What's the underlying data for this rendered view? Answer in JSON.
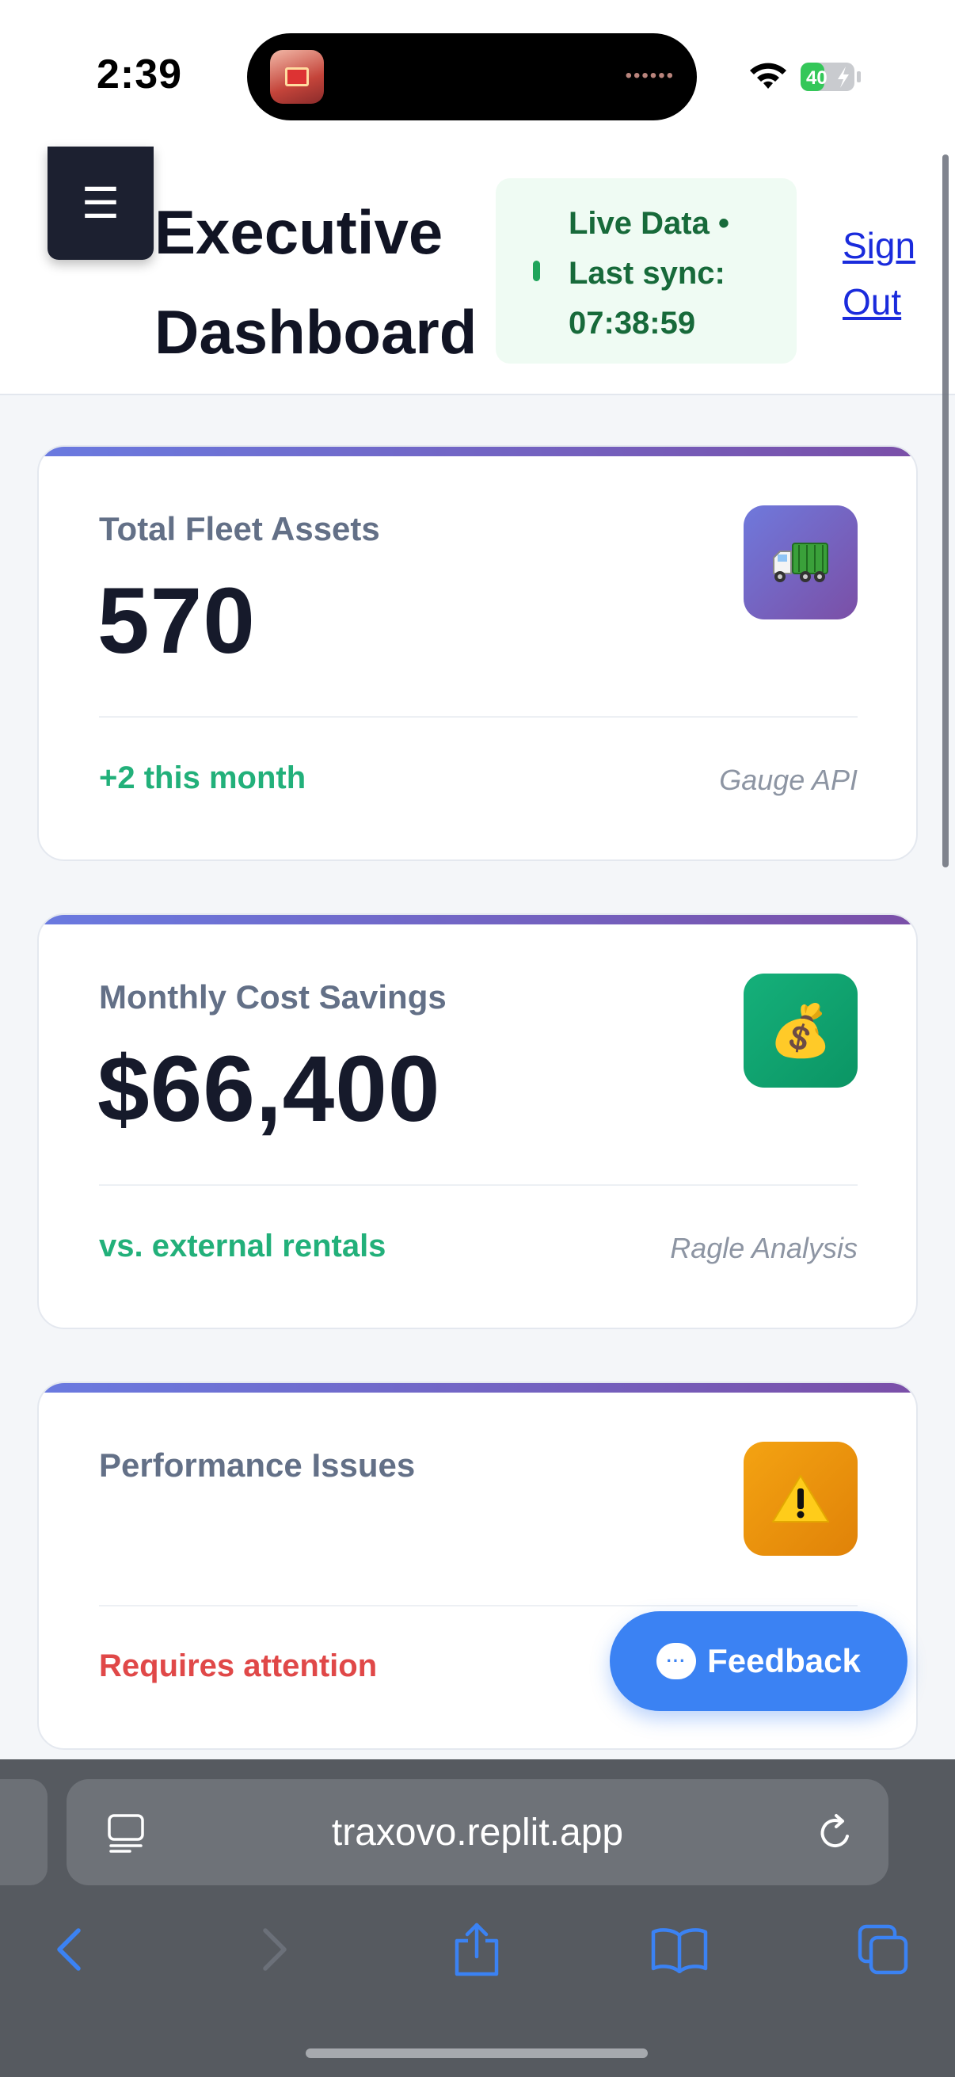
{
  "status_bar": {
    "time": "2:39",
    "battery": "40"
  },
  "header": {
    "menu_icon": "hamburger-icon",
    "menu_glyph": "☰",
    "title_line1": "Executive",
    "title_line2": "Dashboard",
    "live_status": "Live Data • Last sync: 07:38:59",
    "sign_out": "Sign Out"
  },
  "cards": [
    {
      "label": "Total Fleet Assets",
      "value": "570",
      "note": "+2 this month",
      "source": "Gauge API",
      "icon": "truck-icon",
      "icon_color": "#6a5fd6",
      "note_color": "#22b07a"
    },
    {
      "label": "Monthly Cost Savings",
      "value": "$66,400",
      "note": "vs. external rentals",
      "source": "Ragle Analysis",
      "icon": "money-bag-icon",
      "icon_glyph": "💰",
      "icon_color": "#12a872",
      "note_color": "#22b07a"
    },
    {
      "label": "Performance Issues",
      "value": "",
      "note": "Requires attention",
      "source": "",
      "icon": "warning-icon",
      "icon_glyph": "⚠",
      "icon_color": "#f29b0c",
      "note_color": "#e04848"
    }
  ],
  "feedback": {
    "label": "Feedback",
    "icon": "chat-bubble-icon"
  },
  "browser": {
    "url": "traxovo.replit.app",
    "nav_icons": [
      "back-icon",
      "forward-icon",
      "share-icon",
      "bookmarks-icon",
      "tabs-icon"
    ]
  }
}
